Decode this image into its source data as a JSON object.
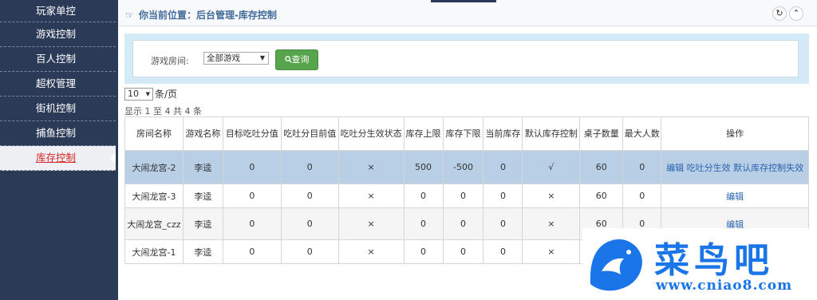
{
  "sidebar": {
    "items": [
      {
        "label": "玩家单控"
      },
      {
        "label": "游戏控制"
      },
      {
        "label": "百人控制"
      },
      {
        "label": "超权管理"
      },
      {
        "label": "街机控制"
      },
      {
        "label": "捕鱼控制"
      },
      {
        "label": "库存控制",
        "active": true
      }
    ]
  },
  "header": {
    "breadcrumb_icon": "☞",
    "breadcrumb": "你当前位置：后台管理-库存控制",
    "refresh_icon": "↻",
    "collapse_icon": "⌃"
  },
  "filter": {
    "label": "游戏房间:",
    "select_value": "全部游戏",
    "query_label": "查询",
    "query_icon": "search-icon"
  },
  "pagination": {
    "page_size": "10",
    "page_size_label": "条/页",
    "info": "显示 1 至 4 共 4 条"
  },
  "table": {
    "headers": [
      "房间名称",
      "游戏名称",
      "目标吃吐分值",
      "吃吐分目前值",
      "吃吐分生效状态",
      "库存上限",
      "库存下限",
      "当前库存",
      "默认库存控制",
      "桌子数量",
      "最大人数",
      "操作"
    ],
    "rows": [
      [
        "大闹龙宫-2",
        "李逵",
        "0",
        "0",
        "×",
        "500",
        "-500",
        "0",
        "√",
        "60",
        "0"
      ],
      [
        "大闹龙宫-3",
        "李逵",
        "0",
        "0",
        "×",
        "0",
        "0",
        "0",
        "×",
        "60",
        "0"
      ],
      [
        "大闹龙宫_czz",
        "李逵",
        "0",
        "0",
        "×",
        "0",
        "0",
        "0",
        "×",
        "60",
        "0"
      ],
      [
        "大闹龙宫-1",
        "李逵",
        "0",
        "0",
        "×",
        "0",
        "0",
        "0",
        "×",
        "",
        ""
      ]
    ],
    "row0_ops": [
      "编辑",
      "吃吐分生效",
      "默认库存控制失效"
    ],
    "edit_label": "编辑"
  },
  "watermark": {
    "title": "菜鸟吧",
    "url": "www.cniao8.com"
  },
  "colors": {
    "sidebar_bg": "#2b3a57",
    "active_text": "#d62828",
    "link": "#2a63b0",
    "query_button": "#56a44b",
    "selected_row": "#b8cfe6",
    "logo": "#1a75e8"
  }
}
